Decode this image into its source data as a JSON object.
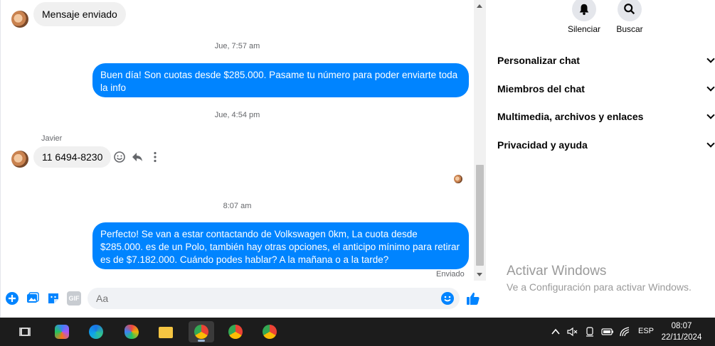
{
  "messages": {
    "msg1": "Mensaje enviado",
    "time1": "Jue, 7:57 am",
    "msg2": "Buen día! Son cuotas desde $285.000. Pasame tu número para poder enviarte toda la info",
    "time2": "Jue, 4:54 pm",
    "sender": "Javier",
    "msg3": "11 6494-8230",
    "time3": "8:07 am",
    "msg4": "Perfecto!  Se van a estar contactando de Volkswagen 0km, La cuota desde $285.000. es de un Polo, también hay otras opciones, el anticipo mínimo para retirar es de $7.182.000. Cuándo podes hablar? A la mañana o a la tarde?",
    "status": "Enviado"
  },
  "composer": {
    "placeholder": "Aa",
    "gif_label": "GIF"
  },
  "side": {
    "mute_label": "Silenciar",
    "search_label": "Buscar",
    "rows": [
      "Personalizar chat",
      "Miembros del chat",
      "Multimedia, archivos y enlaces",
      "Privacidad y ayuda"
    ],
    "watermark_title": "Activar Windows",
    "watermark_sub": "Ve a Configuración para activar Windows."
  },
  "taskbar": {
    "lang": "ESP",
    "time": "08:07",
    "date": "22/11/2024"
  },
  "colors": {
    "accent": "#0084ff",
    "bubble_in": "#f0f0f0",
    "taskbar": "#1c1c1c"
  }
}
